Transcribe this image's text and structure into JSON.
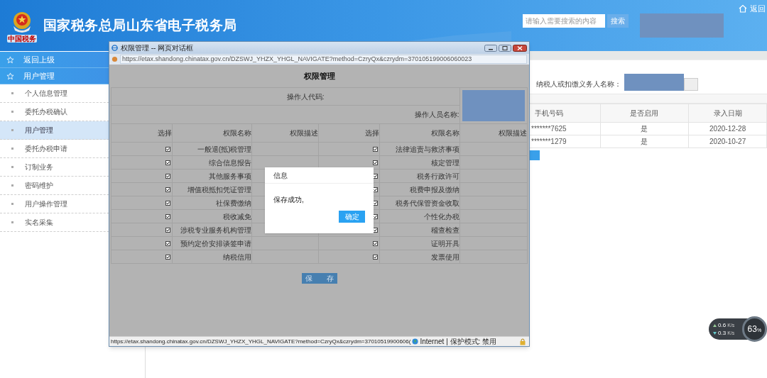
{
  "header": {
    "emblem_caption": "中国税务",
    "title": "国家税务总局山东省电子税务局",
    "search": {
      "placeholder": "请输入需要搜索的内容",
      "button": "搜索"
    },
    "home_link": "返回"
  },
  "sidebar": {
    "sections": [
      {
        "label": "返回上级"
      },
      {
        "label": "用户管理"
      }
    ],
    "items": [
      {
        "label": "个人信息管理",
        "selected": false
      },
      {
        "label": "委托办税确认",
        "selected": false
      },
      {
        "label": "用户管理",
        "selected": true
      },
      {
        "label": "委托办税申请",
        "selected": false
      },
      {
        "label": "订制业务",
        "selected": false
      },
      {
        "label": "密码维护",
        "selected": false
      },
      {
        "label": "用户操作管理",
        "selected": false
      },
      {
        "label": "实名采集",
        "selected": false
      }
    ]
  },
  "main": {
    "taxpayer_label": "纳税人或扣缴义务人名称：",
    "table": {
      "columns": [
        "手机号码",
        "是否启用",
        "录入日期"
      ],
      "rows": [
        [
          "*******7625",
          "是",
          "2020-12-28"
        ],
        [
          "*******1279",
          "是",
          "2020-10-27"
        ]
      ]
    }
  },
  "dialog": {
    "title": "权限管理 -- 网页对话框",
    "address": "https://etax.shandong.chinatax.gov.cn/DZSWJ_YHZX_YHGL_NAVIGATE?method=CzryQx&czrydm=370105199006060023",
    "heading": "权限管理",
    "operator_code_label": "操作人代码:",
    "operator_name_label": "操作人员名称:",
    "columns": [
      "选择",
      "权限名称",
      "权限描述",
      "选择",
      "权限名称",
      "权限描述"
    ],
    "permissions": [
      [
        {
          "name": "一般退(抵)税管理",
          "checked": true
        },
        {
          "name": "法律追责与救济事项",
          "checked": true
        }
      ],
      [
        {
          "name": "综合信息报告",
          "checked": true
        },
        {
          "name": "核定管理",
          "checked": true
        }
      ],
      [
        {
          "name": "其他服务事项",
          "checked": true
        },
        {
          "name": "税务行政许可",
          "checked": true
        }
      ],
      [
        {
          "name": "增值税抵扣凭证管理",
          "checked": true
        },
        {
          "name": "税费申报及缴纳",
          "checked": true
        }
      ],
      [
        {
          "name": "社保费缴纳",
          "checked": true
        },
        {
          "name": "税务代保管资金收取",
          "checked": true
        }
      ],
      [
        {
          "name": "税收减免",
          "checked": true
        },
        {
          "name": "个性化办税",
          "checked": true
        }
      ],
      [
        {
          "name": "涉税专业服务机构管理",
          "checked": true
        },
        {
          "name": "稽查检查",
          "checked": true
        }
      ],
      [
        {
          "name": "预约定价安排谈签申请",
          "checked": true
        },
        {
          "name": "证明开具",
          "checked": true
        }
      ],
      [
        {
          "name": "纳税信用",
          "checked": true
        },
        {
          "name": "发票使用",
          "checked": true
        }
      ]
    ],
    "save_button": "保　　存",
    "status_url": "https://etax.shandong.chinatax.gov.cn/DZSWJ_YHZX_YHGL_NAVIGATE?method=CzryQx&czrydm=37010519900606(",
    "status_zone": "Internet | 保护模式: 禁用"
  },
  "message": {
    "title": "信息",
    "text": "保存成功,",
    "button": "确定"
  },
  "speed_widget": {
    "up": "0.6",
    "up_unit": "K/s",
    "down": "0.3",
    "down_unit": "K/s",
    "percent": "63",
    "percent_sign": "%"
  }
}
